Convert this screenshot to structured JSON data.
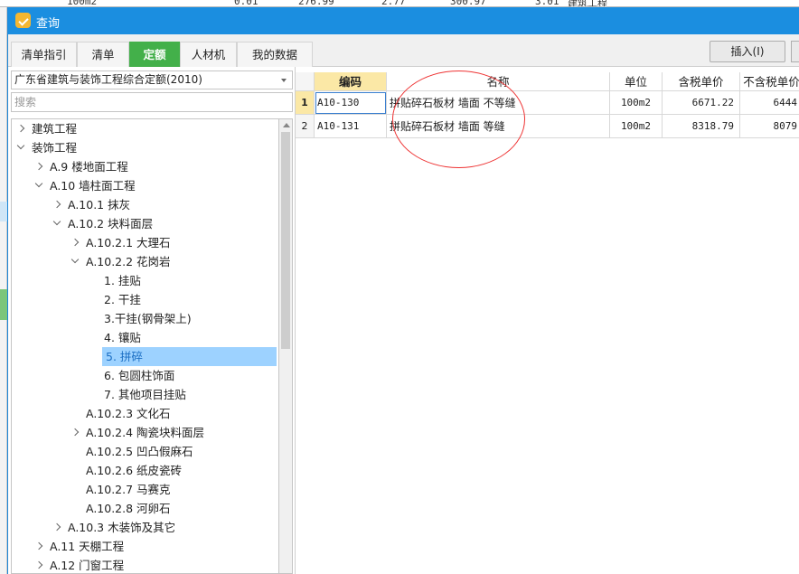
{
  "background": {
    "strip_items": [
      "100m2",
      "0.01",
      "276.99",
      "2.77",
      "300.97",
      "3.01",
      "建筑工程"
    ]
  },
  "dialog": {
    "title": "查询",
    "tabs": [
      {
        "label": "清单指引",
        "active": false
      },
      {
        "label": "清单",
        "active": false
      },
      {
        "label": "定额",
        "active": true
      },
      {
        "label": "人材机",
        "active": false
      },
      {
        "label": "我的数据",
        "active": false
      }
    ],
    "insert_button": "插入(I)"
  },
  "left_panel": {
    "library_select": "广东省建筑与装饰工程综合定额(2010)",
    "search_placeholder": "搜索",
    "tree": [
      {
        "label": "建筑工程",
        "level": 0,
        "expander": "right",
        "selected": false
      },
      {
        "label": "装饰工程",
        "level": 0,
        "expander": "down",
        "selected": false
      },
      {
        "label": "A.9 楼地面工程",
        "level": 1,
        "expander": "right",
        "selected": false
      },
      {
        "label": "A.10 墙柱面工程",
        "level": 1,
        "expander": "down",
        "selected": false
      },
      {
        "label": "A.10.1 抹灰",
        "level": 2,
        "expander": "right",
        "selected": false
      },
      {
        "label": "A.10.2 块料面层",
        "level": 2,
        "expander": "down",
        "selected": false
      },
      {
        "label": "A.10.2.1 大理石",
        "level": 3,
        "expander": "right",
        "selected": false
      },
      {
        "label": "A.10.2.2 花岗岩",
        "level": 3,
        "expander": "down",
        "selected": false
      },
      {
        "label": "1. 挂贴",
        "level": 4,
        "expander": "",
        "selected": false
      },
      {
        "label": "2. 干挂",
        "level": 4,
        "expander": "",
        "selected": false
      },
      {
        "label": "3.干挂(钢骨架上)",
        "level": 4,
        "expander": "",
        "selected": false
      },
      {
        "label": "4. 镶贴",
        "level": 4,
        "expander": "",
        "selected": false
      },
      {
        "label": "5. 拼碎",
        "level": 4,
        "expander": "",
        "selected": true
      },
      {
        "label": "6. 包圆柱饰面",
        "level": 4,
        "expander": "",
        "selected": false
      },
      {
        "label": "7. 其他项目挂贴",
        "level": 4,
        "expander": "",
        "selected": false
      },
      {
        "label": "A.10.2.3 文化石",
        "level": 3,
        "expander": "",
        "selected": false
      },
      {
        "label": "A.10.2.4 陶瓷块料面层",
        "level": 3,
        "expander": "right",
        "selected": false
      },
      {
        "label": "A.10.2.5 凹凸假麻石",
        "level": 3,
        "expander": "",
        "selected": false
      },
      {
        "label": "A.10.2.6 纸皮瓷砖",
        "level": 3,
        "expander": "",
        "selected": false
      },
      {
        "label": "A.10.2.7 马赛克",
        "level": 3,
        "expander": "",
        "selected": false
      },
      {
        "label": "A.10.2.8 河卵石",
        "level": 3,
        "expander": "",
        "selected": false
      },
      {
        "label": "A.10.3 木装饰及其它",
        "level": 2,
        "expander": "right",
        "selected": false
      },
      {
        "label": "A.11 天棚工程",
        "level": 1,
        "expander": "right",
        "selected": false
      },
      {
        "label": "A.12 门窗工程",
        "level": 1,
        "expander": "right",
        "selected": false
      }
    ]
  },
  "grid": {
    "columns": [
      "编码",
      "名称",
      "单位",
      "含税单价",
      "不含税单价"
    ],
    "rows": [
      {
        "num": "1",
        "code": "A10-130",
        "name": "拼贴碎石板材 墙面 不等缝",
        "unit": "100m2",
        "price_tax": "6671.22",
        "price_notax": "6444"
      },
      {
        "num": "2",
        "code": "A10-131",
        "name": "拼贴碎石板材 墙面 等缝",
        "unit": "100m2",
        "price_tax": "8318.79",
        "price_notax": "8079"
      }
    ]
  },
  "colors": {
    "titlebar": "#1b8ee0",
    "active_tab": "#43b04a",
    "selected_node": "#9dd2ff",
    "header_highlight": "#fbe8a6",
    "annotation": "#e33333"
  }
}
